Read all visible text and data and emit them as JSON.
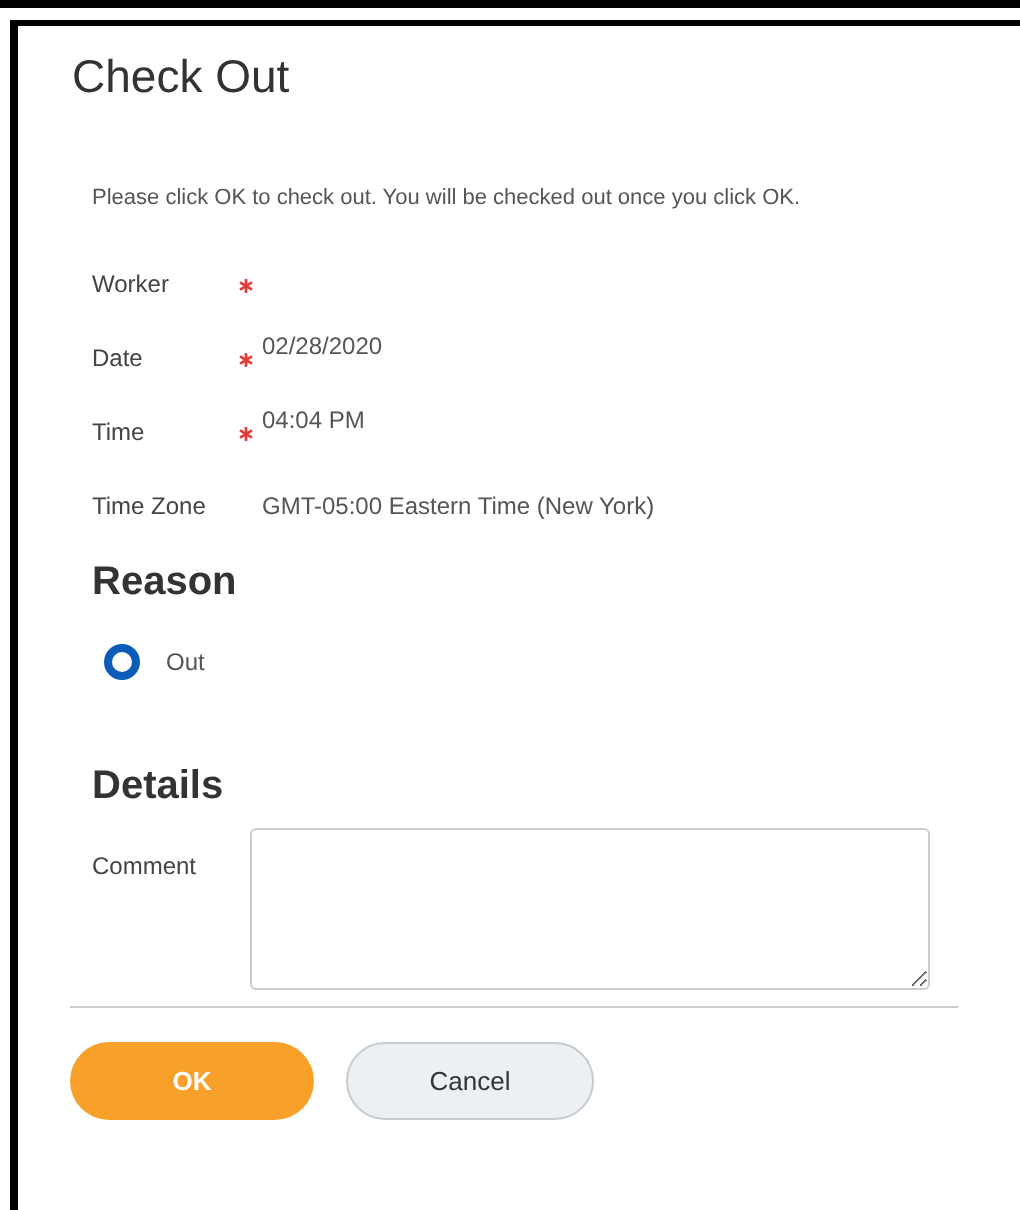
{
  "dialog": {
    "title": "Check Out",
    "instructions": "Please click OK to check out. You will be checked out once you click OK.",
    "fields": [
      {
        "label": "Worker",
        "required": true
      },
      {
        "label": "Date",
        "required": true,
        "value": "02/28/2020"
      },
      {
        "label": "Time",
        "required": true,
        "value": "04:04 PM"
      },
      {
        "label": "Time Zone",
        "required": false,
        "value": "GMT-05:00 Eastern Time (New York)"
      }
    ],
    "reason": {
      "heading": "Reason",
      "options": [
        {
          "label": "Out",
          "selected": true
        }
      ]
    },
    "details": {
      "heading": "Details",
      "comment_label": "Comment"
    },
    "buttons": [
      {
        "label": "OK",
        "kind": "primary"
      },
      {
        "label": "Cancel",
        "kind": "secondary"
      }
    ]
  }
}
